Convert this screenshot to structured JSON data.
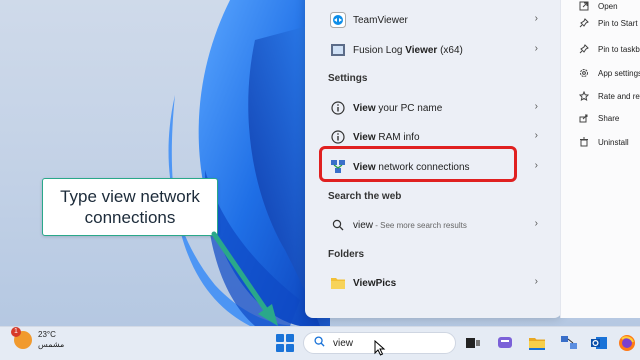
{
  "callout": {
    "text": "Type view network connections"
  },
  "start_menu": {
    "apps": [
      {
        "label": "TeamViewer",
        "icon": "teamviewer-icon"
      },
      {
        "label_prefix": "Fusion Log ",
        "label_bold": "Viewer",
        "label_suffix": " (x64)",
        "icon": "fusion-log-viewer-icon"
      }
    ],
    "settings_heading": "Settings",
    "settings": [
      {
        "bold": "View",
        "rest": " your PC name",
        "icon": "info-icon"
      },
      {
        "bold": "View",
        "rest": " RAM info",
        "icon": "info-icon"
      },
      {
        "bold": "View",
        "rest": " network connections",
        "icon": "network-connections-icon"
      }
    ],
    "web_heading": "Search the web",
    "web_result": {
      "bold": "view",
      "hint": " - See more search results",
      "icon": "search-icon"
    },
    "folders_heading": "Folders",
    "folder": {
      "bold": "ViewPics",
      "icon": "folder-icon"
    }
  },
  "context_menu": [
    {
      "label": "Open",
      "icon": "open-icon"
    },
    {
      "label": "Pin to Start",
      "icon": "pin-icon"
    },
    {
      "label": "Pin to taskbar",
      "icon": "pin-icon"
    },
    {
      "label": "App settings",
      "icon": "gear-icon"
    },
    {
      "label": "Rate and review",
      "icon": "star-icon"
    },
    {
      "label": "Share",
      "icon": "share-icon"
    },
    {
      "label": "Uninstall",
      "icon": "trash-icon"
    }
  ],
  "taskbar": {
    "weather_temp": "23°C",
    "weather_desc": "مشمس",
    "weather_badge": "1",
    "search_value": "view"
  },
  "colors": {
    "accent": "#1a73d8",
    "highlight": "#e02020",
    "callout_border": "#2aa88a"
  }
}
